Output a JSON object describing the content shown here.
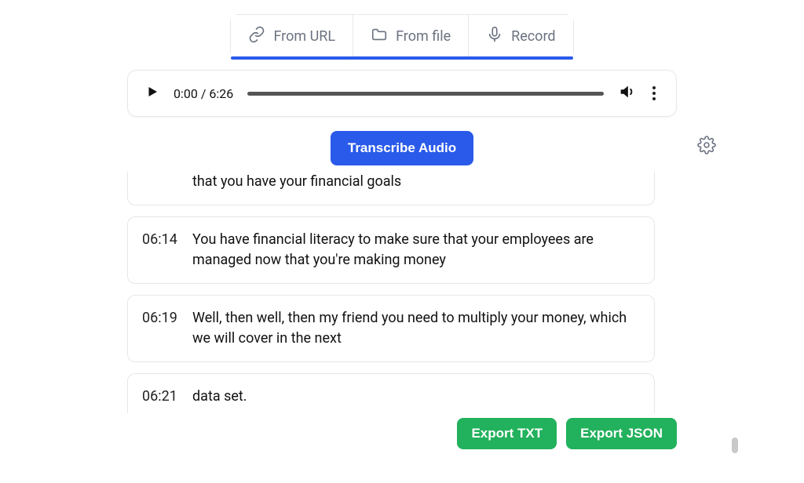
{
  "tabs": {
    "from_url": "From URL",
    "from_file": "From file",
    "record": "Record"
  },
  "audio": {
    "current_time": "0:00",
    "duration": "6:26"
  },
  "actions": {
    "transcribe": "Transcribe Audio",
    "export_txt": "Export TXT",
    "export_json": "Export JSON"
  },
  "transcript": {
    "segments": [
      {
        "ts": "",
        "text": "that you have your financial goals"
      },
      {
        "ts": "06:14",
        "text": "You have financial literacy to make sure that your employees are managed now that you're making money"
      },
      {
        "ts": "06:19",
        "text": "Well, then well, then my friend you need to multiply your money, which we will cover in the next"
      },
      {
        "ts": "06:21",
        "text": "data set."
      }
    ]
  }
}
